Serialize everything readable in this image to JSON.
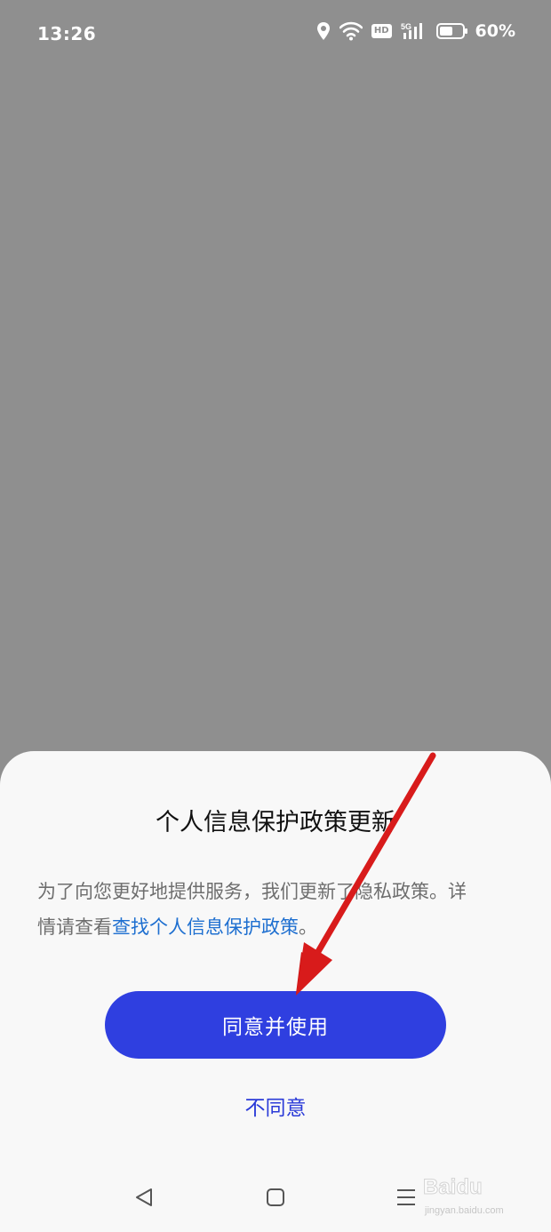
{
  "status_bar": {
    "time": "13:26",
    "icons": [
      "location-icon",
      "wifi-icon",
      "hd-icon",
      "5g-signal-icon",
      "battery-icon"
    ],
    "hd_label": "HD",
    "network_label": "5G",
    "battery_percent": "60%",
    "battery_level": 0.6
  },
  "dialog": {
    "title": "个人信息保护政策更新",
    "body_prefix": "为了向您更好地提供服务，我们更新了隐私政策。详情请查看",
    "policy_link": "查找个人信息保护政策",
    "body_suffix": "。",
    "agree_label": "同意并使用",
    "disagree_label": "不同意"
  },
  "nav_bar": {
    "buttons": [
      "back-icon",
      "home-icon",
      "menu-icon"
    ]
  },
  "watermark": {
    "brand": "Baidu",
    "sub": "jingyan.baidu.com"
  },
  "colors": {
    "overlay": "#8f8f8f",
    "sheet": "#f8f8f8",
    "primary_button": "#2f3fe0",
    "link": "#1e6fd0",
    "annotation_arrow": "#e01414"
  }
}
